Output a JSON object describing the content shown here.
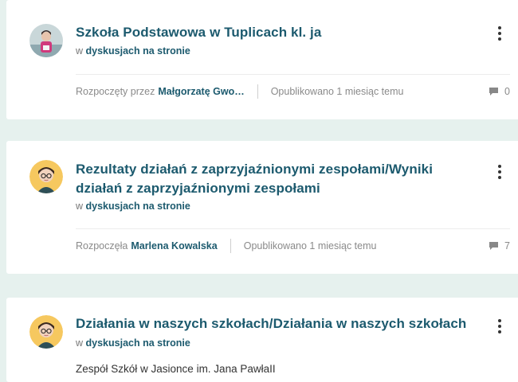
{
  "posts": [
    {
      "title": "Szkoła Podstawowa w Tuplicach kl. ja",
      "where_prefix": "w",
      "where_link": "dyskusjach na stronie",
      "started_prefix": "Rozpoczęty przez",
      "author": "Małgorzatę Gwo…",
      "published": "Opublikowano 1 miesiąc temu",
      "comment_count": "0",
      "avatar": "photo-child-icon"
    },
    {
      "title": "Rezultaty działań z zaprzyjaźnionymi zespołami/Wyniki działań z zaprzyjaźnionymi zespołami",
      "where_prefix": "w",
      "where_link": "dyskusjach na stronie",
      "started_prefix": "Rozpoczęła",
      "author": "Marlena Kowalska",
      "published": "Opublikowano 1 miesiąc temu",
      "comment_count": "7",
      "avatar": "woman-glasses-icon"
    },
    {
      "title": "Działania w naszych szkołach/Działania w naszych szkołach",
      "where_prefix": "w",
      "where_link": "dyskusjach na stronie",
      "excerpt": "Zespół Szkół w Jasionce im. Jana PawłaII",
      "avatar": "woman-glasses-icon"
    }
  ],
  "colors": {
    "background": "#e6f1ee",
    "title": "#1c5a6e",
    "meta": "#8a8a8a",
    "avatar_bg": "#f6c85f"
  }
}
